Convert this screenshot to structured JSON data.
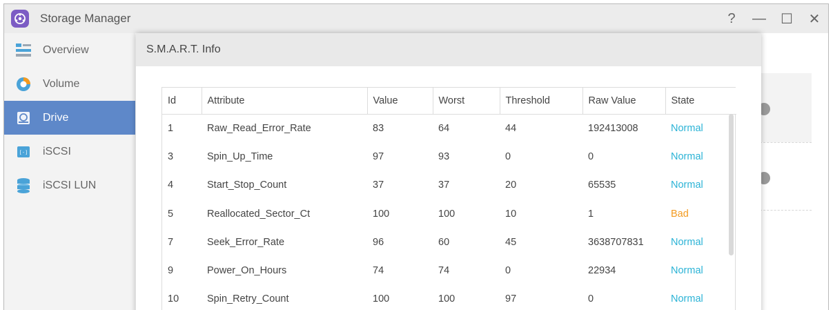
{
  "window": {
    "title": "Storage Manager",
    "controls": {
      "help": "?",
      "minimize": "—",
      "maximize": "☐",
      "close": "✕"
    }
  },
  "sidebar": {
    "items": [
      {
        "label": "Overview",
        "icon": "overview-icon",
        "active": false
      },
      {
        "label": "Volume",
        "icon": "volume-pie-icon",
        "active": false
      },
      {
        "label": "Drive",
        "icon": "drive-icon",
        "active": true
      },
      {
        "label": "iSCSI",
        "icon": "iscsi-icon",
        "active": false
      },
      {
        "label": "iSCSI LUN",
        "icon": "iscsi-lun-icon",
        "active": false
      }
    ]
  },
  "dialog": {
    "title": "S.M.A.R.T. Info",
    "table": {
      "columns": [
        "Id",
        "Attribute",
        "Value",
        "Worst",
        "Threshold",
        "Raw Value",
        "State"
      ],
      "rows": [
        [
          "1",
          "Raw_Read_Error_Rate",
          "83",
          "64",
          "44",
          "192413008",
          "Normal"
        ],
        [
          "3",
          "Spin_Up_Time",
          "97",
          "93",
          "0",
          "0",
          "Normal"
        ],
        [
          "4",
          "Start_Stop_Count",
          "37",
          "37",
          "20",
          "65535",
          "Normal"
        ],
        [
          "5",
          "Reallocated_Sector_Ct",
          "100",
          "100",
          "10",
          "1",
          "Bad"
        ],
        [
          "7",
          "Seek_Error_Rate",
          "96",
          "60",
          "45",
          "3638707831",
          "Normal"
        ],
        [
          "9",
          "Power_On_Hours",
          "74",
          "74",
          "0",
          "22934",
          "Normal"
        ],
        [
          "10",
          "Spin_Retry_Count",
          "100",
          "100",
          "97",
          "0",
          "Normal"
        ]
      ]
    }
  },
  "colors": {
    "accent": "#5e88c9",
    "state_normal": "#2bb3d6",
    "state_bad": "#f39a1e",
    "app_icon": "#7c5cc4"
  }
}
